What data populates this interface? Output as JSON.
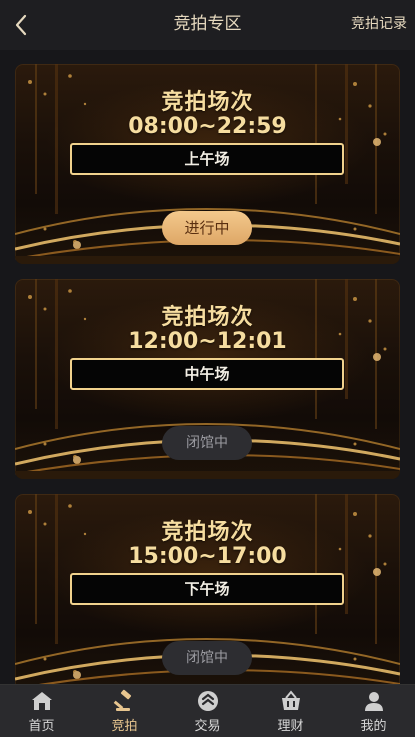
{
  "header": {
    "title": "竞拍专区",
    "right_link": "竞拍记录",
    "back_icon": "chevron-left-icon"
  },
  "cards": [
    {
      "title": "竞拍场次",
      "time": "08:00~22:59",
      "session": "上午场",
      "status": "进行中",
      "state": "active"
    },
    {
      "title": "竞拍场次",
      "time": "12:00~12:01",
      "session": "中午场",
      "status": "闭馆中",
      "state": "closed"
    },
    {
      "title": "竞拍场次",
      "time": "15:00~17:00",
      "session": "下午场",
      "status": "闭馆中",
      "state": "closed"
    }
  ],
  "nav": [
    {
      "label": "首页",
      "icon": "home-icon"
    },
    {
      "label": "竞拍",
      "icon": "gavel-icon",
      "active": true
    },
    {
      "label": "交易",
      "icon": "exchange-icon"
    },
    {
      "label": "理财",
      "icon": "basket-icon"
    },
    {
      "label": "我的",
      "icon": "user-icon"
    }
  ],
  "colors": {
    "accent": "#f6dda0",
    "active_button": "#e8b877",
    "background": "#17171a"
  }
}
